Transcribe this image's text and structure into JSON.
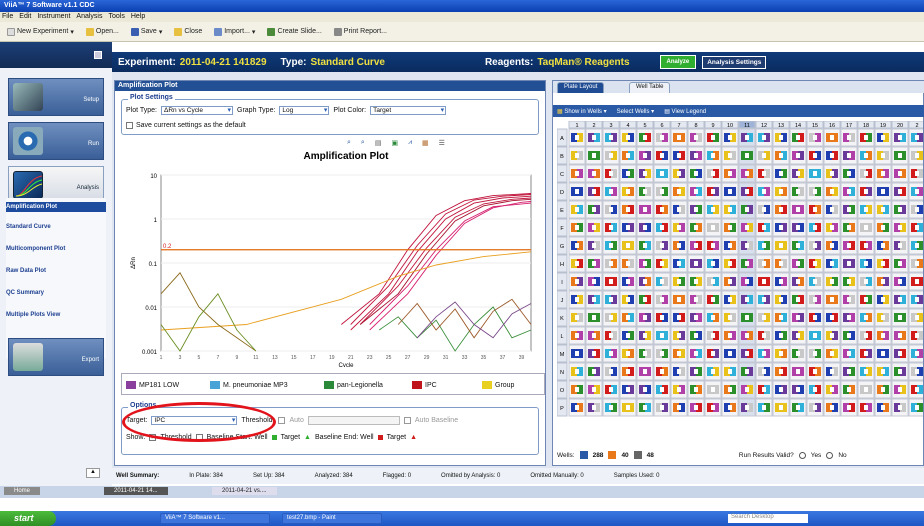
{
  "window": {
    "title": "ViiA™ 7 Software v1.1 CDC"
  },
  "menu": [
    "File",
    "Edit",
    "Instrument",
    "Analysis",
    "Tools",
    "Help"
  ],
  "toolbar": {
    "new_experiment": "New Experiment",
    "open": "Open...",
    "save": "Save",
    "close": "Close",
    "import": "Import...",
    "create_slide": "Create Slide...",
    "print_report": "Print Report..."
  },
  "sidebar": {
    "setup": "Setup",
    "run": "Run",
    "analysis": "Analysis",
    "export": "Export",
    "links": [
      "Amplification Plot",
      "Standard Curve",
      "Multicomponent Plot",
      "Raw Data Plot",
      "QC Summary",
      "Multiple Plots View"
    ]
  },
  "experiment": {
    "label": "Experiment:",
    "name": "2011-04-21 141829",
    "type_label": "Type:",
    "type": "Standard Curve",
    "reagents_label": "Reagents:",
    "reagents": "TaqMan® Reagents",
    "analyze_button": "Analyze",
    "settings_button": "Analysis Settings"
  },
  "amp_panel": {
    "title": "Amplification Plot",
    "plot_settings_label": "Plot Settings",
    "plot_type_label": "Plot Type:",
    "plot_type": "ΔRn vs Cycle",
    "graph_type_label": "Graph Type:",
    "graph_type": "Log",
    "plot_color_label": "Plot Color:",
    "plot_color": "Target",
    "save_settings": "Save current settings as the default",
    "options_label": "Options",
    "target_label": "Target:",
    "target": "IPC",
    "threshold_label": "Threshold:",
    "auto_label": "Auto",
    "auto_baseline": "Auto Baseline",
    "show_label": "Show:",
    "threshold_check": "Threshold",
    "baseline_start": "Baseline Start: Well",
    "target_a": "Target",
    "baseline_end": "Baseline End: Well",
    "target_b": "Target"
  },
  "chart_data": {
    "type": "line",
    "title": "Amplification Plot",
    "xlabel": "Cycle",
    "ylabel": "ΔRn",
    "yscale": "log",
    "ylim": [
      0.001,
      10
    ],
    "yticks": [
      "10",
      "1",
      "0.1",
      "0.01",
      "0.001"
    ],
    "xlim": [
      1,
      40
    ],
    "threshold": 0.2,
    "threshold_label": "0.2",
    "series": [
      {
        "color": "#c0143c",
        "values": [
          [
            20,
            0.004
          ],
          [
            24,
            0.02
          ],
          [
            27,
            0.2
          ],
          [
            30,
            1.2
          ],
          [
            33,
            2.6
          ],
          [
            36,
            3.4
          ],
          [
            40,
            3.8
          ]
        ]
      },
      {
        "color": "#c0143c",
        "values": [
          [
            21,
            0.004
          ],
          [
            25,
            0.03
          ],
          [
            28,
            0.25
          ],
          [
            31,
            1.3
          ],
          [
            34,
            2.7
          ],
          [
            37,
            3.3
          ],
          [
            40,
            3.6
          ]
        ]
      },
      {
        "color": "#c0143c",
        "values": [
          [
            21,
            0.003
          ],
          [
            25,
            0.02
          ],
          [
            28,
            0.18
          ],
          [
            31,
            1.0
          ],
          [
            34,
            2.3
          ],
          [
            37,
            3.0
          ],
          [
            40,
            3.3
          ]
        ]
      },
      {
        "color": "#c0143c",
        "values": [
          [
            22,
            0.004
          ],
          [
            26,
            0.03
          ],
          [
            29,
            0.22
          ],
          [
            32,
            1.1
          ],
          [
            35,
            2.2
          ],
          [
            38,
            2.8
          ],
          [
            40,
            3.0
          ]
        ]
      },
      {
        "color": "#a9122f",
        "values": [
          [
            22,
            0.004
          ],
          [
            26,
            0.02
          ],
          [
            29,
            0.16
          ],
          [
            32,
            0.9
          ],
          [
            35,
            2.0
          ],
          [
            38,
            2.6
          ],
          [
            40,
            2.8
          ]
        ]
      },
      {
        "color": "#d6206e",
        "values": [
          [
            23,
            0.003
          ],
          [
            27,
            0.02
          ],
          [
            30,
            0.15
          ],
          [
            33,
            0.8
          ],
          [
            36,
            1.8
          ],
          [
            39,
            2.4
          ],
          [
            40,
            2.5
          ]
        ]
      },
      {
        "color": "#d6206e",
        "values": [
          [
            23,
            0.004
          ],
          [
            27,
            0.03
          ],
          [
            30,
            0.2
          ],
          [
            33,
            0.9
          ],
          [
            36,
            1.9
          ],
          [
            40,
            2.3
          ]
        ]
      },
      {
        "color": "#e8a020",
        "values": [
          [
            1,
            0.003
          ],
          [
            10,
            0.004
          ],
          [
            20,
            0.015
          ],
          [
            26,
            0.05
          ],
          [
            30,
            0.09
          ],
          [
            35,
            0.14
          ],
          [
            40,
            0.18
          ]
        ]
      },
      {
        "color": "#8a6a1a",
        "values": [
          [
            1,
            0.02
          ],
          [
            3,
            0.06
          ],
          [
            5,
            0.01
          ],
          [
            7,
            0.004
          ],
          [
            9,
            0.002
          ],
          [
            11,
            0.001
          ]
        ]
      },
      {
        "color": "#6b8e23",
        "values": [
          [
            1,
            0.004
          ],
          [
            3,
            0.001
          ],
          [
            5,
            0.006
          ],
          [
            7,
            0.02
          ],
          [
            9,
            0.003
          ],
          [
            11,
            0.001
          ]
        ]
      },
      {
        "color": "#3b8e3b",
        "values": [
          [
            24,
            0.003
          ],
          [
            26,
            0.006
          ],
          [
            28,
            0.002
          ],
          [
            30,
            0.005
          ],
          [
            32,
            0.001
          ],
          [
            34,
            0.004
          ],
          [
            36,
            0.01
          ],
          [
            38,
            0.002
          ],
          [
            40,
            0.003
          ]
        ]
      },
      {
        "color": "#9c5a2a",
        "values": [
          [
            26,
            0.004
          ],
          [
            28,
            0.012
          ],
          [
            30,
            0.003
          ],
          [
            32,
            0.009
          ],
          [
            34,
            0.002
          ],
          [
            36,
            0.008
          ],
          [
            38,
            0.015
          ],
          [
            40,
            0.004
          ]
        ]
      },
      {
        "color": "#7a4a8a",
        "values": [
          [
            28,
            0.002
          ],
          [
            30,
            0.006
          ],
          [
            32,
            0.013
          ],
          [
            34,
            0.004
          ],
          [
            36,
            0.002
          ],
          [
            38,
            0.007
          ],
          [
            40,
            0.012
          ]
        ]
      }
    ]
  },
  "plot_legend": [
    {
      "label": "MP181 LOW",
      "color": "#8a3f9e"
    },
    {
      "label": "M. pneumoniae MP3",
      "color": "#4aa3d6"
    },
    {
      "label": "pan-Legionella",
      "color": "#2a8a3a"
    },
    {
      "label": "IPC",
      "color": "#c0141c"
    },
    {
      "label": "Group",
      "color": "#e8d020"
    }
  ],
  "right_panel": {
    "tab_plate_layout": "Plate Layout",
    "tab_well_table": "Well Table",
    "show_in_wells": "Show in Wells",
    "select_wells": "Select Wells",
    "view_legend": "View Legend",
    "columns": [
      "1",
      "2",
      "3",
      "4",
      "5",
      "6",
      "7",
      "8",
      "9",
      "10",
      "11",
      "12",
      "13",
      "14",
      "15",
      "16",
      "17",
      "18",
      "19",
      "20",
      "2"
    ],
    "rows": [
      "A",
      "B",
      "C",
      "D",
      "E",
      "F",
      "G",
      "H",
      "I",
      "J",
      "K",
      "L",
      "M",
      "N",
      "O",
      "P"
    ],
    "wells_label": "Wells:",
    "wells_count_a": "288",
    "wells_count_b": "40",
    "wells_count_c": "48",
    "run_results_label": "Run Results Valid?",
    "yes": "Yes",
    "no": "No"
  },
  "well_summary": {
    "label": "Well Summary:",
    "in_plate": "In Plate: 384",
    "set_up": "Set Up: 384",
    "analyzed": "Analyzed: 384",
    "flagged": "Flagged: 0",
    "omitted_by_analysis": "Omitted by Analysis: 0",
    "omitted_manually": "Omitted Manually: 0",
    "samples_used": "Samples Used: 0"
  },
  "doc_tabs": [
    "Home",
    "2011-04-21 14...",
    "2011-04-21 vs...."
  ],
  "taskbar": {
    "start": "start",
    "tasks": [
      "ViiA™ 7 Software v1...",
      "test27.bmp - Paint"
    ],
    "search": "Search Desktop"
  },
  "plate_colors": [
    "#1f3fb0",
    "#2b8f2b",
    "#d21c1c",
    "#e8c21a",
    "#b03fa8",
    "#2fb0d8",
    "#e8781a",
    "#6a3a9a",
    "#c8c8c8"
  ]
}
